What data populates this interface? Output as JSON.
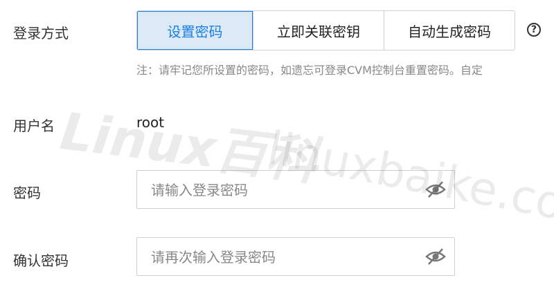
{
  "login_method": {
    "label": "登录方式",
    "options": [
      {
        "label": "设置密码",
        "active": true
      },
      {
        "label": "立即关联密钥",
        "active": false
      },
      {
        "label": "自动生成密码",
        "active": false
      }
    ],
    "help_icon": "question-circle-icon",
    "note": "注：请牢记您所设置的密码，如遗忘可登录CVM控制台重置密码。自定"
  },
  "username": {
    "label": "用户名",
    "value": "root"
  },
  "password": {
    "label": "密码",
    "placeholder": "请输入登录密码",
    "icon": "eye-slash-icon"
  },
  "confirm_password": {
    "label": "确认密码",
    "placeholder": "请再次输入登录密码",
    "icon": "eye-slash-icon"
  },
  "watermark": {
    "line1": "Linux百科",
    "line2": "linuxbaike.com"
  },
  "colors": {
    "accent": "#1a7fe0",
    "active_bg": "#dceaf8",
    "border": "#cfcfcf",
    "muted_text": "#888888"
  }
}
